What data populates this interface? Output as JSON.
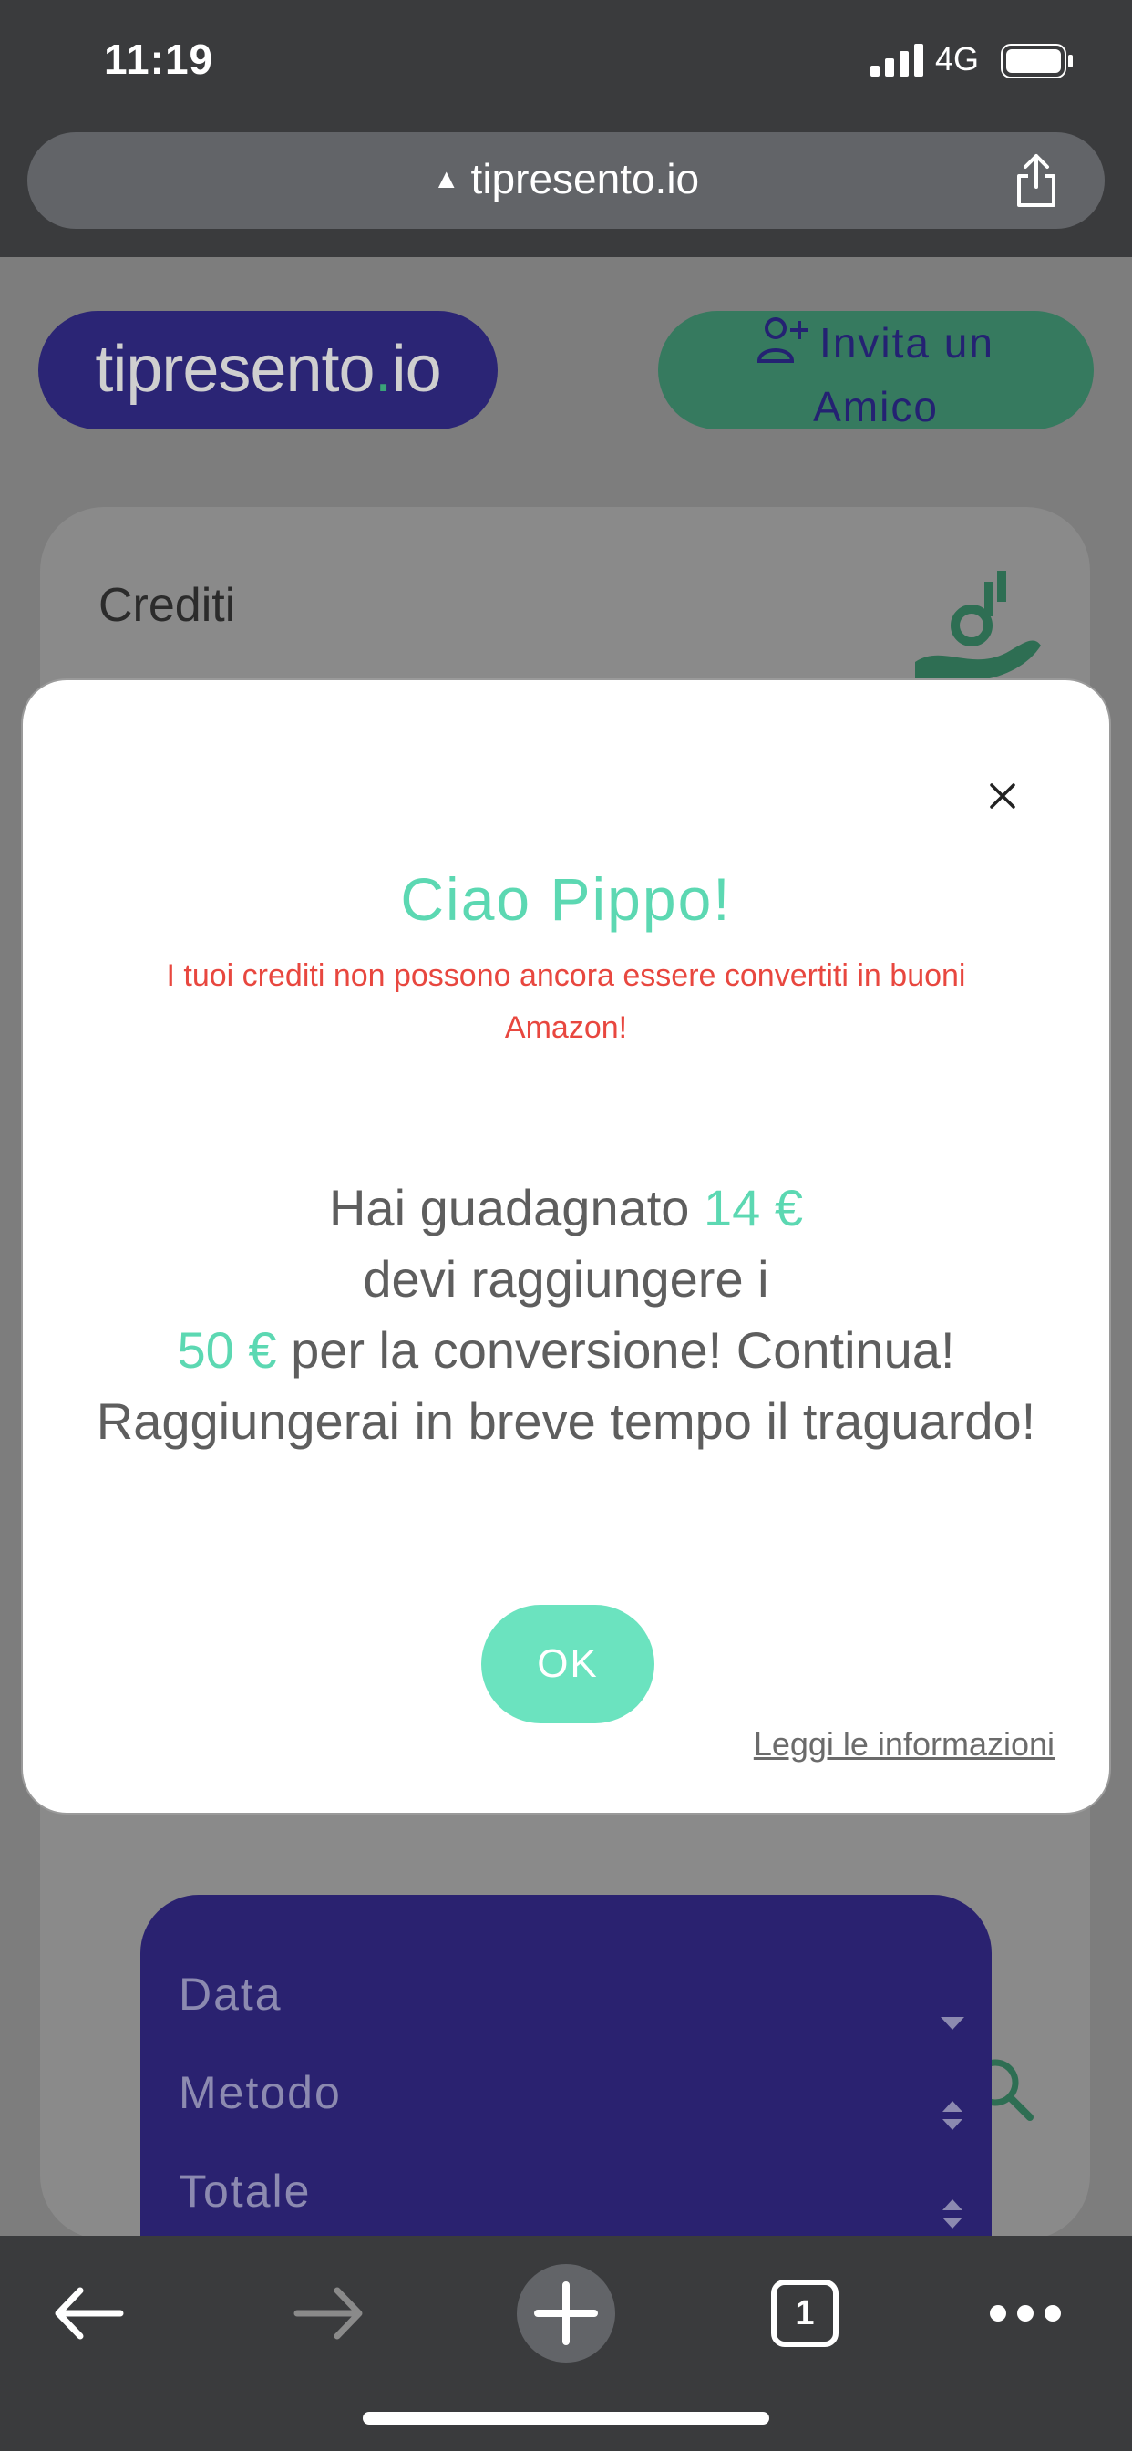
{
  "status": {
    "time": "11:19",
    "network": "4G"
  },
  "browser": {
    "url": "tipresento.io"
  },
  "header": {
    "logo_main": "tipresento",
    "logo_dot": ".",
    "logo_suffix": "io",
    "invite_line1": "Invita un",
    "invite_line2": "Amico"
  },
  "card": {
    "title": "Crediti"
  },
  "table": {
    "headers": [
      "Data",
      "Metodo",
      "Totale"
    ]
  },
  "modal": {
    "greeting": "Ciao Pippo!",
    "warning": "I tuoi crediti non possono ancora essere convertiti in buoni Amazon!",
    "earned_prefix": "Hai guadagnato",
    "earned_amount": "14 €",
    "goal_prefix": "devi raggiungere i",
    "goal_amount": "50 €",
    "goal_suffix": "per la conversione! Continua! Raggiungerai in breve tempo il traguardo!",
    "ok_label": "OK",
    "info_link": "Leggi le informazioni"
  },
  "toolbar": {
    "tabs_count": "1"
  },
  "colors": {
    "accent_green": "#5cd8b2",
    "warning_red": "#e8473f",
    "brand_purple": "#2b2575"
  }
}
